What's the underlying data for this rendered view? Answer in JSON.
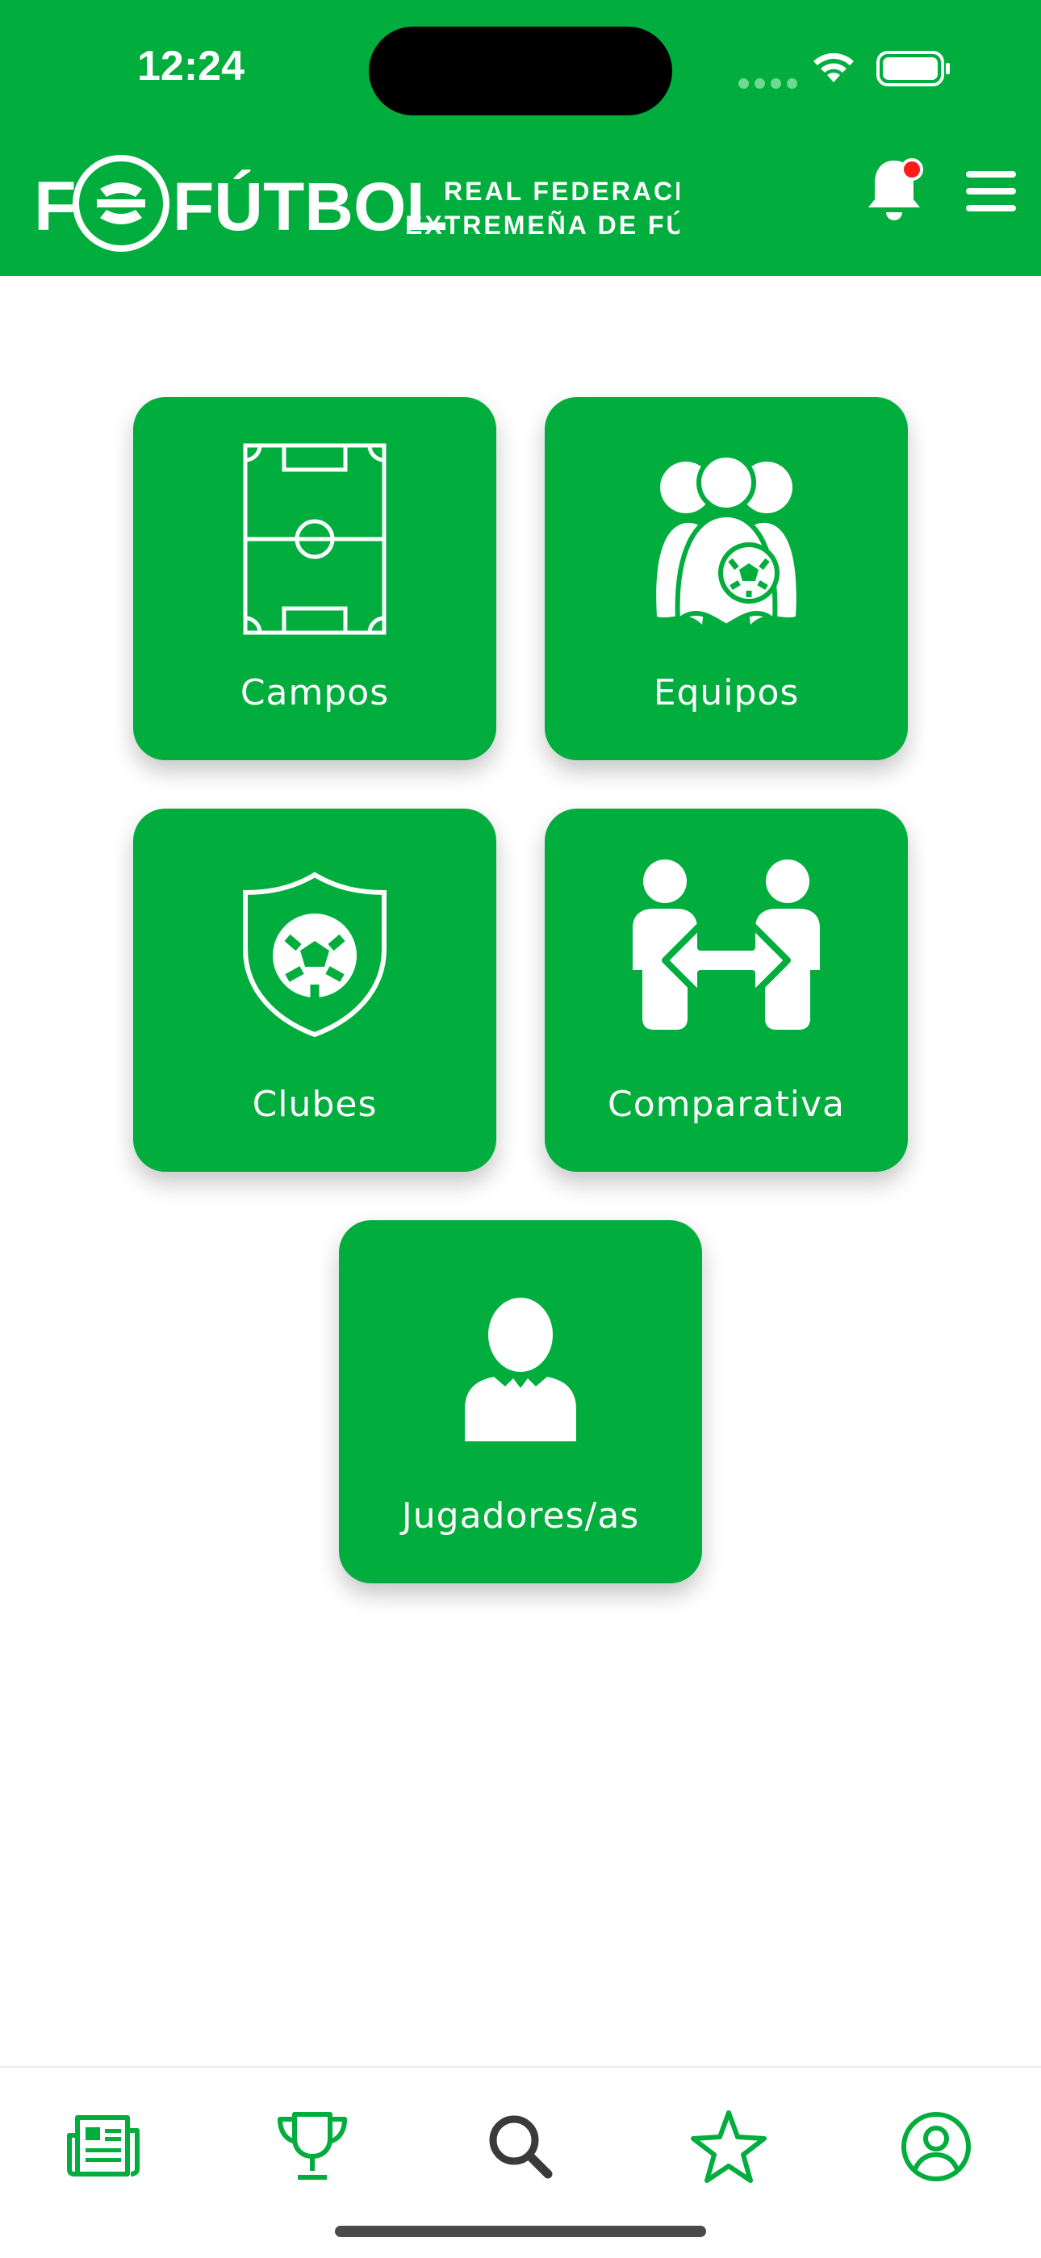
{
  "status_bar": {
    "time": "12:24"
  },
  "header": {
    "logo_main": "FÚTBOL",
    "logo_line1": "REAL FEDERACIÓN",
    "logo_line2": "EXTREMEÑA DE FÚTBOL",
    "notification_icon": "bell-icon",
    "menu_icon": "hamburger-menu-icon"
  },
  "tiles": [
    {
      "label": "Campos",
      "icon": "football-field-icon"
    },
    {
      "label": "Equipos",
      "icon": "team-icon"
    },
    {
      "label": "Clubes",
      "icon": "club-shield-icon"
    },
    {
      "label": "Comparativa",
      "icon": "compare-players-icon"
    },
    {
      "label": "Jugadores/as",
      "icon": "player-icon"
    }
  ],
  "bottom_nav": [
    {
      "icon": "news-icon",
      "active": false
    },
    {
      "icon": "trophy-icon",
      "active": false
    },
    {
      "icon": "search-icon",
      "active": true
    },
    {
      "icon": "star-icon",
      "active": false
    },
    {
      "icon": "profile-icon",
      "active": false
    }
  ],
  "colors": {
    "brand_green": "#00ad3d",
    "notification_dot": "#ff1a1a",
    "active_nav": "#3a3a3a"
  }
}
